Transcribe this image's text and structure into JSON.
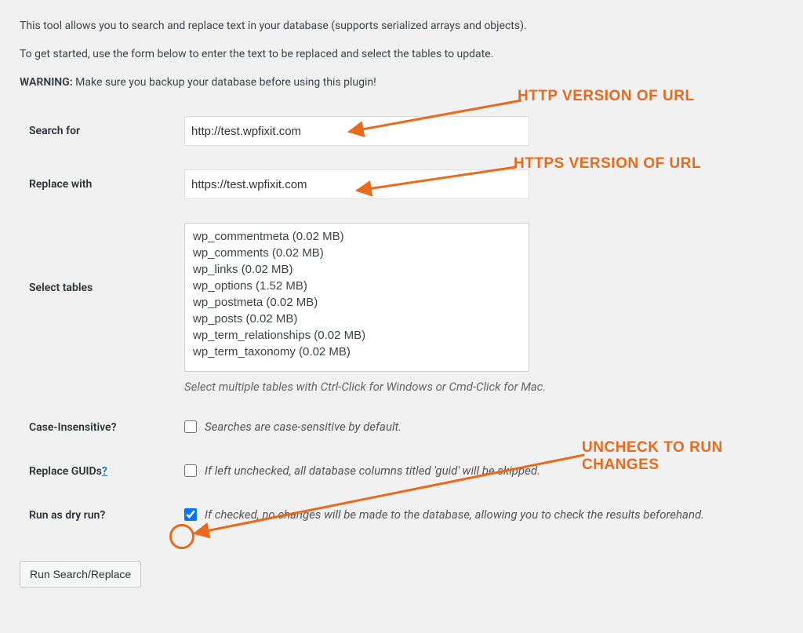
{
  "intro": {
    "line1": "This tool allows you to search and replace text in your database (supports serialized arrays and objects).",
    "line2": "To get started, use the form below to enter the text to be replaced and select the tables to update.",
    "warn_label": "WARNING:",
    "warn_text": " Make sure you backup your database before using this plugin!"
  },
  "form": {
    "search_label": "Search for",
    "search_value": "http://test.wpfixit.com",
    "replace_label": "Replace with",
    "replace_value": "https://test.wpfixit.com",
    "tables_label": "Select tables",
    "tables_hint": "Select multiple tables with Ctrl-Click for Windows or Cmd-Click for Mac.",
    "tables": [
      "wp_commentmeta (0.02 MB)",
      "wp_comments (0.02 MB)",
      "wp_links (0.02 MB)",
      "wp_options (1.52 MB)",
      "wp_postmeta (0.02 MB)",
      "wp_posts (0.02 MB)",
      "wp_term_relationships (0.02 MB)",
      "wp_term_taxonomy (0.02 MB)"
    ],
    "case_label": "Case-Insensitive?",
    "case_desc": "Searches are case-sensitive by default.",
    "guid_label": "Replace GUIDs",
    "guid_help": "?",
    "guid_desc": "If left unchecked, all database columns titled 'guid' will be skipped.",
    "dry_label": "Run as dry run?",
    "dry_desc": "If checked, no changes will be made to the database, allowing you to check the results beforehand.",
    "submit": "Run Search/Replace"
  },
  "annot": {
    "a1": "HTTP VERSION OF URL",
    "a2": "HTTPS VERSION OF URL",
    "a3": "UNCHECK TO RUN CHANGES"
  }
}
